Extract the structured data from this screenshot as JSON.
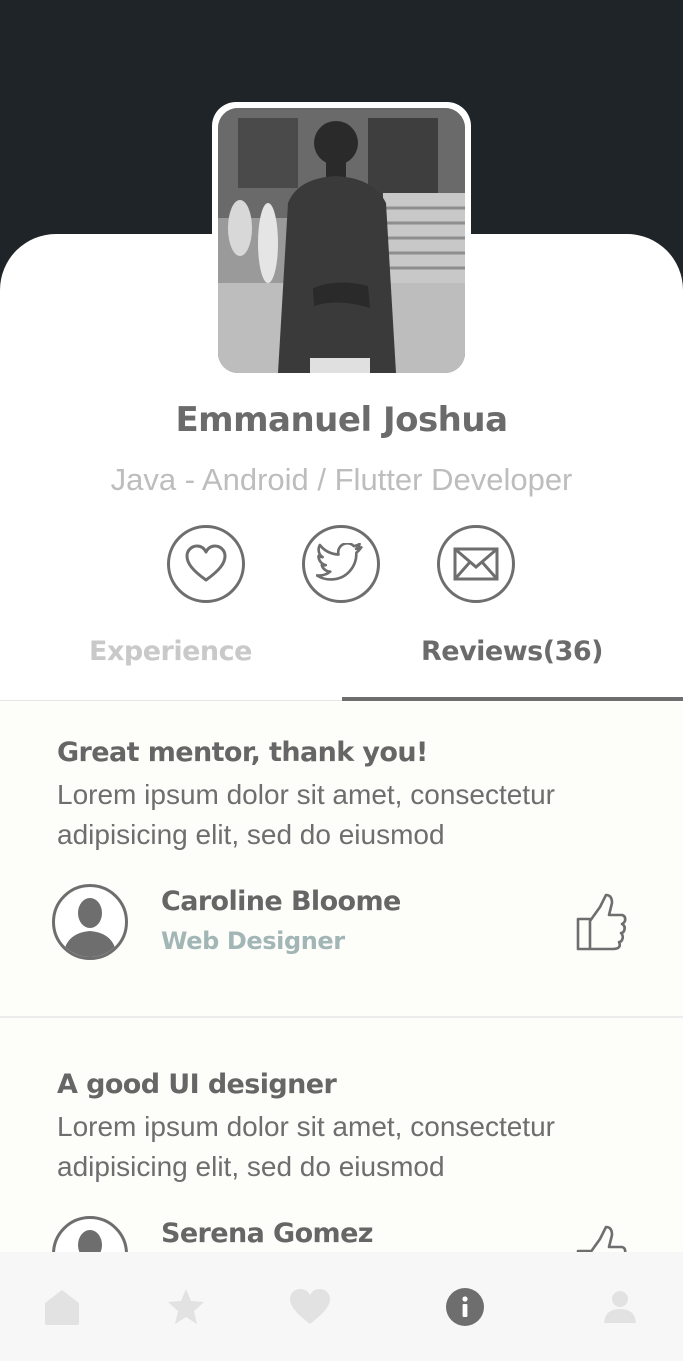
{
  "profile": {
    "name": "Emmanuel Joshua",
    "role": "Java - Android / Flutter Developer",
    "photo_icon": "profile-photo"
  },
  "social": [
    {
      "icon": "heart-icon"
    },
    {
      "icon": "twitter-icon"
    },
    {
      "icon": "mail-icon"
    }
  ],
  "tabs": {
    "experience": "Experience",
    "reviews": "Reviews(36)",
    "active": "reviews"
  },
  "reviews": [
    {
      "title": "Great mentor, thank you!",
      "body": "Lorem ipsum dolor sit amet, consectetur adipisicing elit, sed do eiusmod",
      "reviewer": "Caroline Bloome",
      "reviewer_role": "Web Designer"
    },
    {
      "title": "A good UI designer",
      "body": "Lorem ipsum dolor sit amet, consectetur adipisicing elit, sed do eiusmod",
      "reviewer": "Serena Gomez",
      "reviewer_role": ""
    }
  ],
  "bottom_nav": [
    {
      "icon": "home-icon",
      "active": false
    },
    {
      "icon": "star-icon",
      "active": false
    },
    {
      "icon": "heart-icon",
      "active": false
    },
    {
      "icon": "info-icon",
      "active": true
    },
    {
      "icon": "person-icon",
      "active": false
    }
  ],
  "colors": {
    "header_bg": "#1e2428",
    "text_dark": "#6b6b6b",
    "text_muted": "#bdbdbd",
    "accent_role": "#a3b6b6",
    "nav_inactive": "#e2e2e2",
    "nav_active": "#6e6e6e"
  }
}
